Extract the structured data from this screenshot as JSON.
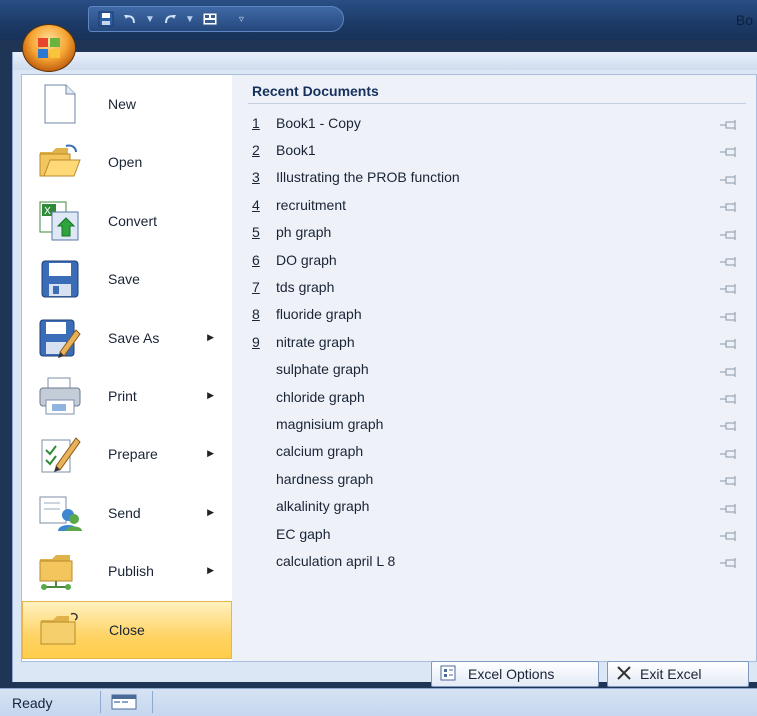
{
  "window": {
    "title": "Bo"
  },
  "menu_items": [
    {
      "label": "New",
      "has_arrow": false,
      "icon": "new-document-icon"
    },
    {
      "label": "Open",
      "has_arrow": false,
      "icon": "open-folder-icon"
    },
    {
      "label": "Convert",
      "has_arrow": false,
      "icon": "convert-icon"
    },
    {
      "label": "Save",
      "has_arrow": false,
      "icon": "save-icon"
    },
    {
      "label": "Save As",
      "has_arrow": true,
      "icon": "save-as-icon"
    },
    {
      "label": "Print",
      "has_arrow": true,
      "icon": "print-icon"
    },
    {
      "label": "Prepare",
      "has_arrow": true,
      "icon": "prepare-icon"
    },
    {
      "label": "Send",
      "has_arrow": true,
      "icon": "send-icon"
    },
    {
      "label": "Publish",
      "has_arrow": true,
      "icon": "publish-icon"
    },
    {
      "label": "Close",
      "has_arrow": false,
      "icon": "close-folder-icon",
      "selected": true
    }
  ],
  "recent": {
    "title": "Recent Documents",
    "documents": [
      {
        "num": "1",
        "name": "Book1 - Copy"
      },
      {
        "num": "2",
        "name": "Book1"
      },
      {
        "num": "3",
        "name": "Illustrating the PROB function"
      },
      {
        "num": "4",
        "name": "recruitment"
      },
      {
        "num": "5",
        "name": "ph graph"
      },
      {
        "num": "6",
        "name": "DO graph"
      },
      {
        "num": "7",
        "name": "tds graph"
      },
      {
        "num": "8",
        "name": "fluoride graph"
      },
      {
        "num": "9",
        "name": "nitrate graph"
      },
      {
        "num": "",
        "name": "sulphate graph"
      },
      {
        "num": "",
        "name": "chloride graph"
      },
      {
        "num": "",
        "name": "magnisium graph"
      },
      {
        "num": "",
        "name": "calcium graph"
      },
      {
        "num": "",
        "name": "hardness graph"
      },
      {
        "num": "",
        "name": "alkalinity graph"
      },
      {
        "num": "",
        "name": "EC gaph"
      },
      {
        "num": "",
        "name": "calculation april L 8"
      }
    ]
  },
  "buttons": {
    "options": "Excel Options",
    "exit": "Exit Excel"
  },
  "status": {
    "text": "Ready"
  },
  "colors": {
    "selected_bg": "#ffd465",
    "panel_bg": "#dce7f5",
    "title_bar": "#1c3a66"
  }
}
